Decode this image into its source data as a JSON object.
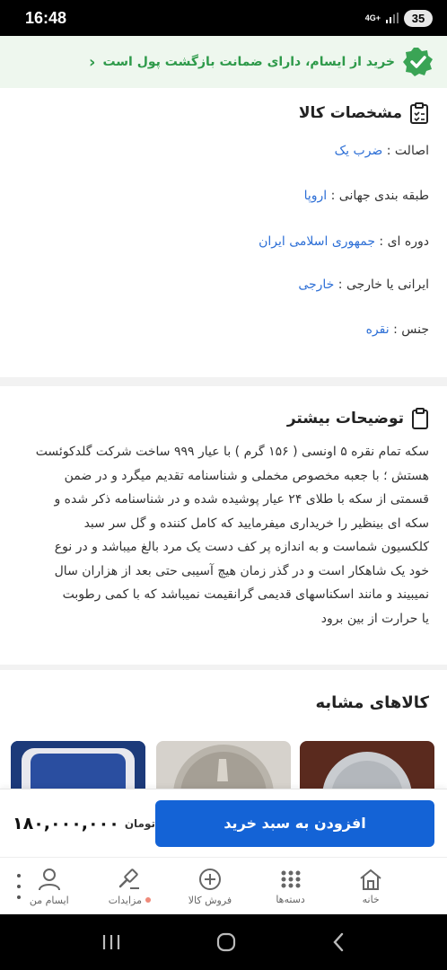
{
  "status_bar": {
    "time": "16:48",
    "network": "4G+",
    "battery": "35"
  },
  "guarantee": {
    "text": "خرید از ایسام، دارای ضمانت بازگشت پول است"
  },
  "specs": {
    "title": "مشخصات کالا",
    "rows": [
      {
        "label": "اصالت : ",
        "value": "ضرب یک"
      },
      {
        "label": "طبقه بندی جهانی : ",
        "value": "اروپا"
      },
      {
        "label": "دوره ای : ",
        "value": "جمهوری اسلامی ایران"
      },
      {
        "label": "ایرانی یا خارجی : ",
        "value": "خارجی"
      },
      {
        "label": "جنس : ",
        "value": "نقره"
      }
    ]
  },
  "description": {
    "title": "توضیحات بیشتر",
    "lines": [
      "سکه تمام نقره ۵ اونسی ( ۱۵۶ گرم ) با عیار ۹۹۹ ساخت شرکت گلدکوئست",
      "هستش ؛ با جعبه مخصوص مخملی و شناسنامه تقدیم میگرد و در ضمن",
      "قسمتی از سکه با طلای ۲۴ عیار پوشیده شده و در شناسنامه ذکر شده و",
      "سکه ای بینظیر را خریداری میفرمایید که کامل کننده و گل سر سبد",
      "کلکسیون شماست و به اندازه پر کف دست یک مرد بالغ میباشد و در نوع",
      "خود یک شاهکار است و در گذر زمان هیچ آسیبی حتی بعد از هزاران سال",
      "نمیبیند و مانند اسکناسهای قدیمی گرانقیمت نمیباشد که با کمی رطوبت",
      "یا حرارت از بین برود"
    ]
  },
  "similar": {
    "title": "کالاهای مشابه"
  },
  "purchase": {
    "price": "۱۸۰,۰۰۰,۰۰۰",
    "unit": "تومان",
    "button": "افزودن به سبد خرید"
  },
  "nav": {
    "items": [
      {
        "label": "خانه",
        "icon": "home-icon"
      },
      {
        "label": "دسته‌ها",
        "icon": "grid-icon"
      },
      {
        "label": "فروش کالا",
        "icon": "plus-circle-icon"
      },
      {
        "label": "مزایدات",
        "icon": "gavel-icon"
      },
      {
        "label": "ایسام من",
        "icon": "user-icon"
      }
    ]
  },
  "colors": {
    "accent": "#1463d6",
    "green": "#2e9a4a",
    "link": "#2d6fd6"
  }
}
